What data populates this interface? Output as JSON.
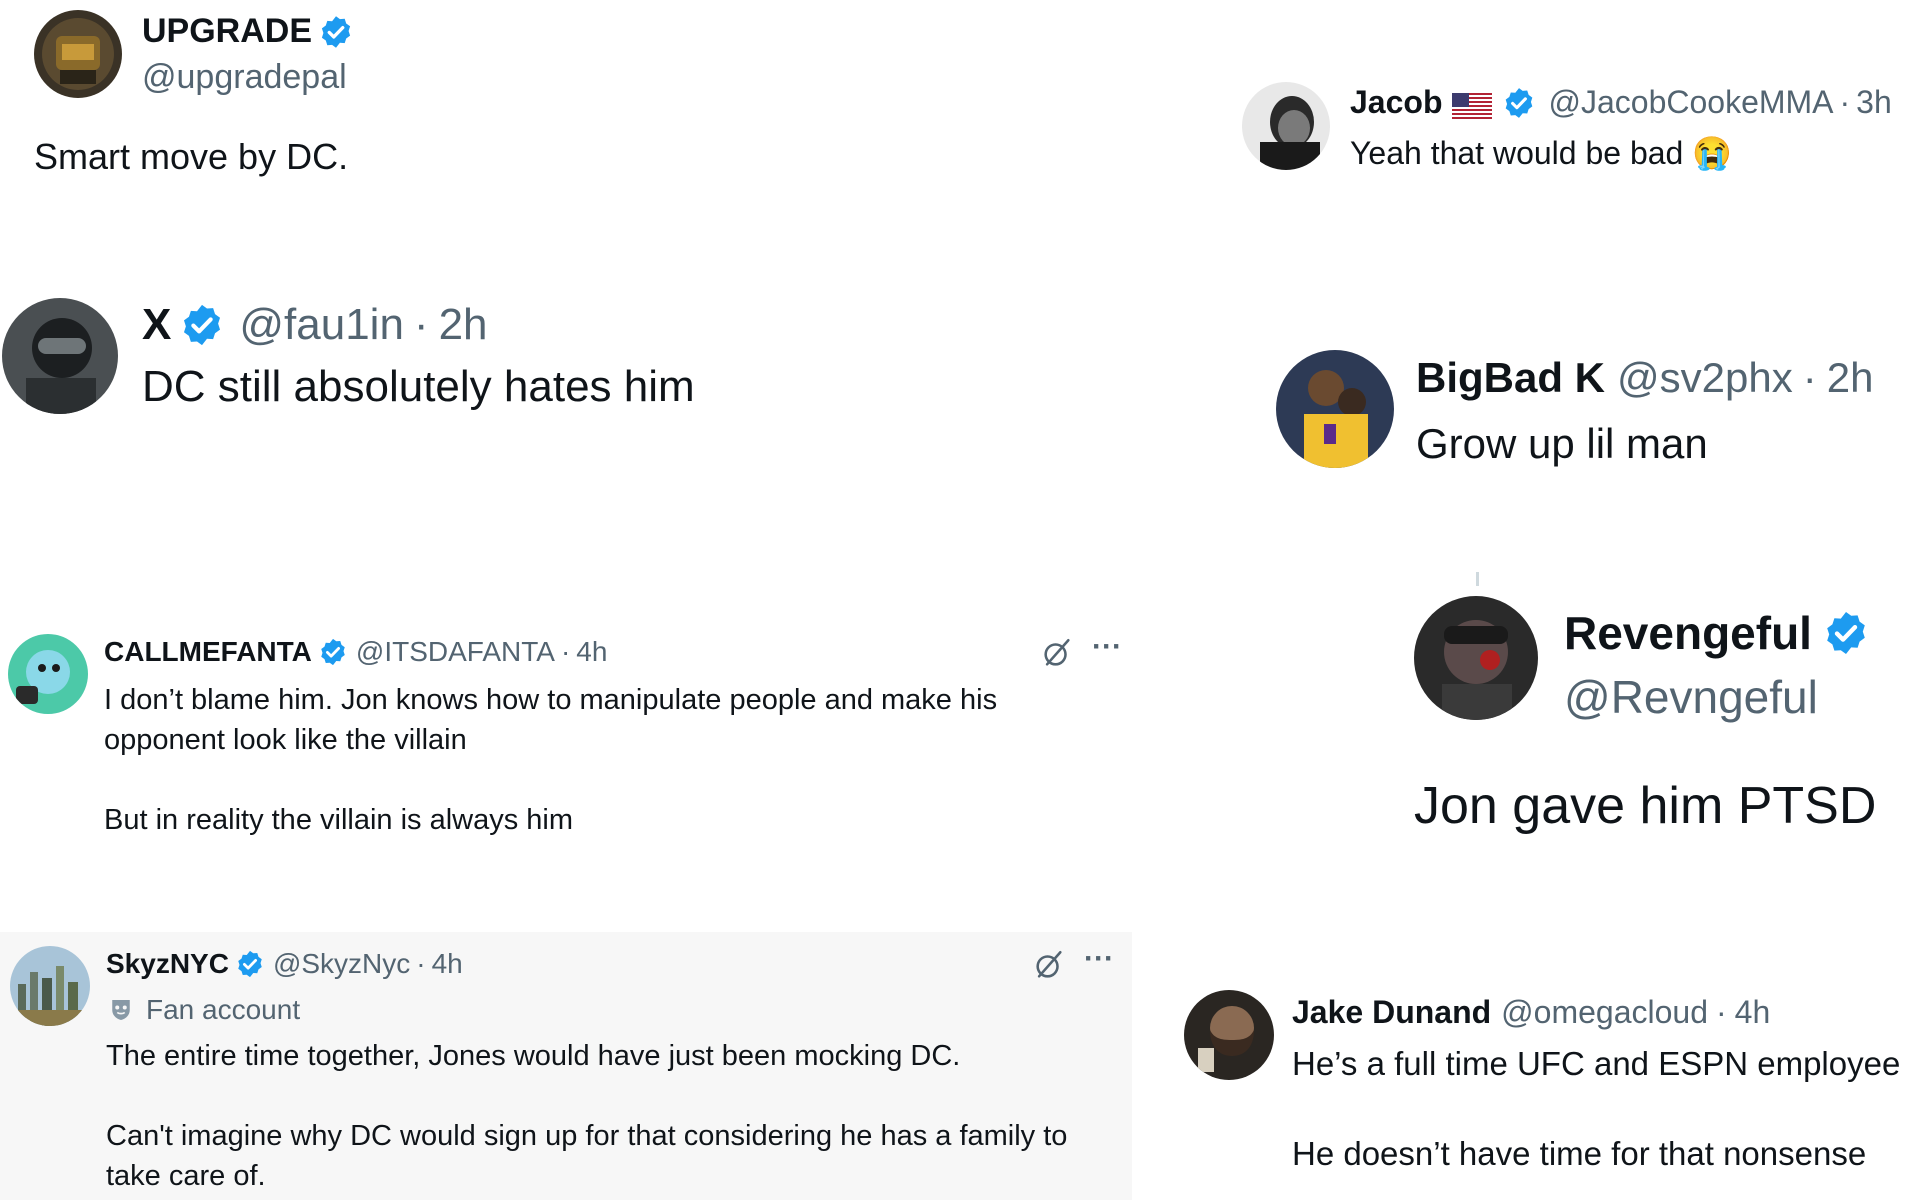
{
  "colors": {
    "verified": "#1d9bf0",
    "secondary_text": "#536471",
    "highlight_bg": "#f7f7f7"
  },
  "tweets": [
    {
      "name": "UPGRADE",
      "handle": "@upgradepal",
      "text": "Smart move by DC."
    },
    {
      "name": "Jacob",
      "handle": "@JacobCookeMMA",
      "time": "3h",
      "sep": "·",
      "text": "Yeah that would be bad 😭"
    },
    {
      "name": "X",
      "handle": "@fau1in",
      "time": "2h",
      "sep": "·",
      "text": "DC still absolutely hates him"
    },
    {
      "name": "BigBad K",
      "handle": "@sv2phx",
      "time": "2h",
      "sep": "·",
      "text": "Grow up lil man"
    },
    {
      "name": "CALLMEFANTA",
      "handle": "@ITSDAFANTA",
      "time": "4h",
      "sep": "·",
      "text1": "I don’t blame him. Jon knows how to manipulate people and make his opponent look like the villain",
      "text2": "But in reality the villain is always him",
      "more": "···"
    },
    {
      "name": "Revengeful",
      "handle": "@Revngeful",
      "text": "Jon gave him PTSD"
    },
    {
      "name": "SkyzNYC",
      "handle": "@SkyzNyc",
      "time": "4h",
      "sep": "·",
      "label": "Fan account",
      "text1": "The entire time together, Jones would have just been mocking DC.",
      "text2": "Can't imagine why DC would sign up for that considering he has a family to take care of.",
      "more": "···"
    },
    {
      "name": "Jake Dunand",
      "handle": "@omegacloud",
      "time": "4h",
      "sep": "·",
      "text1": "He’s a full time UFC and ESPN employee",
      "text2": "He doesn’t have time for that nonsense"
    }
  ]
}
